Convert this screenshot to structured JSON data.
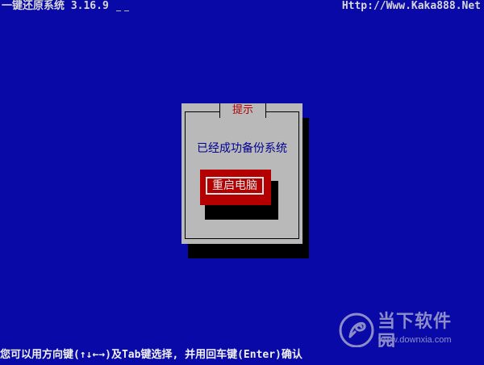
{
  "app": {
    "title": "一键还原系统 3.16.9",
    "url": "Http://Www.Kaka888.Net"
  },
  "dialog": {
    "title": "提示",
    "message": "已经成功备份系统",
    "button_label": "重启电脑"
  },
  "status_bar": {
    "hint": "您可以用方向键(↑↓←→)及Tab键选择, 并用回车键(Enter)确认"
  },
  "watermark": {
    "brand": "当下软件园",
    "url": "www.downxia.com"
  },
  "colors": {
    "background": "#0909A8",
    "dialog_bg": "#B9B9B9",
    "accent_red": "#B40000",
    "text_light": "#D8D8D8"
  }
}
